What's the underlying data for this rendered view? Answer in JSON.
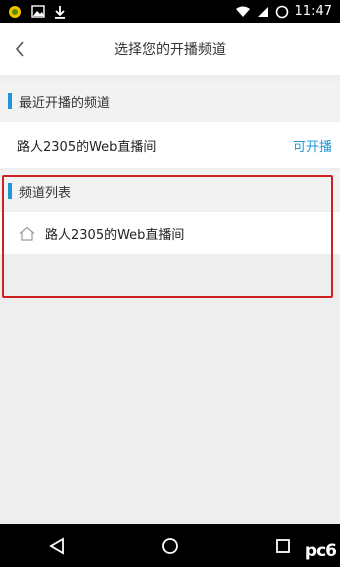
{
  "status_bar": {
    "time": "11:47",
    "left_icons": [
      "app-notification-icon",
      "image-icon",
      "download-icon"
    ],
    "right_icons": [
      "wifi-icon",
      "signal-icon",
      "battery-icon"
    ]
  },
  "header": {
    "title": "选择您的开播频道"
  },
  "recent": {
    "section_title": "最近开播的频道",
    "channel_name": "路人2305的Web直播间",
    "action_label": "可开播"
  },
  "channels": {
    "section_title": "频道列表",
    "items": [
      {
        "name": "路人2305的Web直播间"
      }
    ]
  },
  "colors": {
    "accent": "#1e96d6",
    "highlight": "#cc2222",
    "background": "#eeeeee"
  },
  "watermark": {
    "text": "pc6"
  }
}
